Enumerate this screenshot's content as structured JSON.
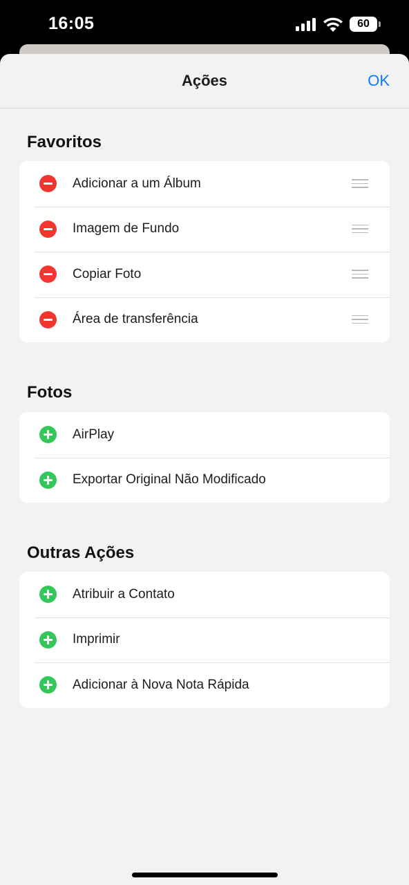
{
  "status_bar": {
    "time": "16:05",
    "battery_level": "60",
    "signal_icon": "cellular-signal-icon",
    "wifi_icon": "wifi-icon"
  },
  "sheet": {
    "title": "Ações",
    "done_label": "OK",
    "accent_color": "#0a7aff"
  },
  "sections": [
    {
      "title": "Favoritos",
      "items": [
        {
          "label": "Adicionar a um Álbum",
          "state": "remove"
        },
        {
          "label": "Imagem de Fundo",
          "state": "remove"
        },
        {
          "label": "Copiar Foto",
          "state": "remove"
        },
        {
          "label": "Área de transferência",
          "state": "remove"
        }
      ]
    },
    {
      "title": "Fotos",
      "items": [
        {
          "label": "AirPlay",
          "state": "add"
        },
        {
          "label": "Exportar Original Não Modificado",
          "state": "add"
        }
      ]
    },
    {
      "title": "Outras Ações",
      "items": [
        {
          "label": "Atribuir a Contato",
          "state": "add"
        },
        {
          "label": "Imprimir",
          "state": "add"
        },
        {
          "label": "Adicionar à Nova Nota Rápida",
          "state": "add"
        }
      ]
    }
  ],
  "colors": {
    "remove": "#f2362f",
    "add": "#33c759"
  }
}
